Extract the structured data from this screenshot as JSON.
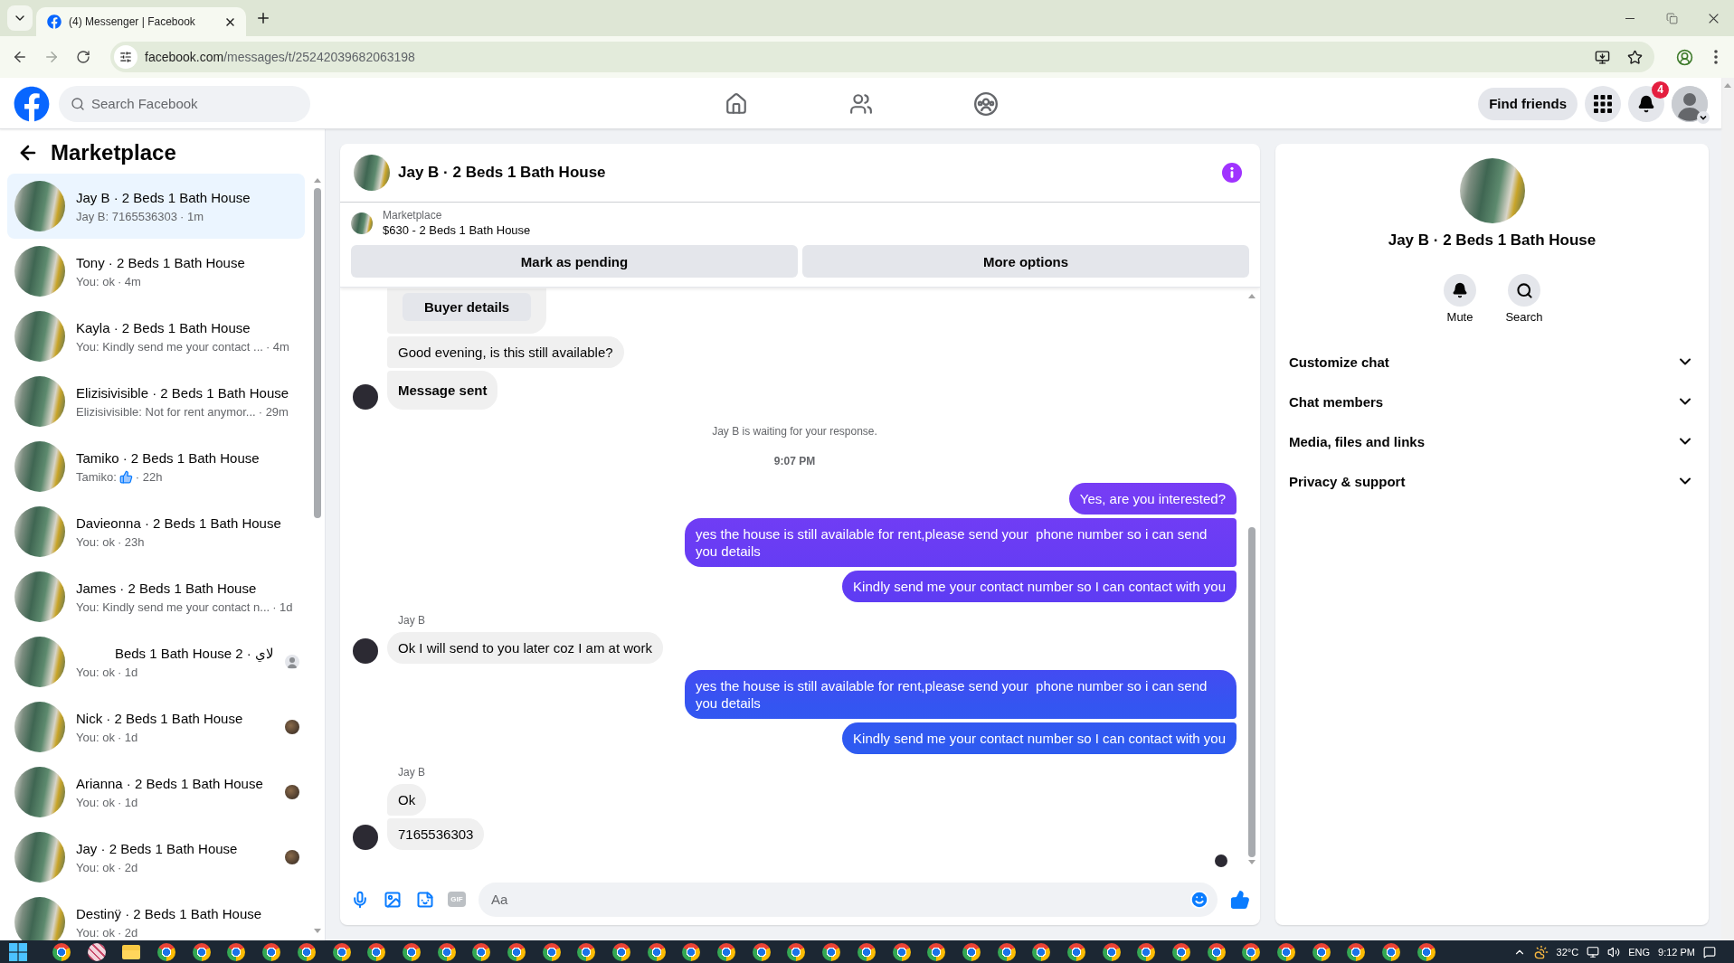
{
  "browser": {
    "tab": {
      "title": "(4) Messenger | Facebook",
      "selected": true
    },
    "address": {
      "domain": "facebook.com",
      "path": "/messages/t/25242039682063198"
    }
  },
  "header": {
    "search": {
      "placeholder": "Search Facebook"
    },
    "nav": [
      {
        "kind": "home",
        "selected": false
      },
      {
        "kind": "friends",
        "selected": false
      },
      {
        "kind": "groups",
        "selected": false
      }
    ],
    "find_friends": "Find friends",
    "notification_count": "4"
  },
  "sidebar": {
    "title": "Marketplace",
    "conversations": [
      {
        "title": "Jay B · 2 Beds 1 Bath House",
        "preview": "Jay B: 7165536303",
        "time": "· 1m",
        "kind": "text",
        "seen": false,
        "selected": true
      },
      {
        "title": "Tony · 2 Beds 1 Bath House",
        "preview": "You: ok",
        "time": "· 4m",
        "kind": "text",
        "seen": false,
        "selected": false
      },
      {
        "title": "Kayla · 2 Beds 1 Bath House",
        "preview": "You: Kindly send me your contact ...",
        "time": "· 4m",
        "kind": "text",
        "seen": false,
        "selected": false
      },
      {
        "title": "Elizisivisible · 2 Beds 1 Bath House",
        "preview": "Elizisivisible: Not for rent anymor...",
        "time": "· 29m",
        "kind": "text",
        "seen": false,
        "selected": false
      },
      {
        "title": "Tamiko · 2 Beds 1 Bath House",
        "preview": "Tamiko:",
        "time": "· 22h",
        "kind": "like",
        "seen": false,
        "selected": false
      },
      {
        "title": "Davieonna · 2 Beds 1 Bath House",
        "preview": "You: ok",
        "time": "· 23h",
        "kind": "text",
        "seen": false,
        "selected": false
      },
      {
        "title": "James · 2 Beds 1 Bath House",
        "preview": "You: Kindly send me your contact n...",
        "time": "· 1d",
        "kind": "text",
        "seen": false,
        "selected": false
      },
      {
        "title": "لاي · 2 Beds 1 Bath House",
        "preview": "You: ok",
        "time": "· 1d",
        "kind": "text",
        "seen": true,
        "seen_photo": false,
        "selected": false
      },
      {
        "title": "Nick · 2 Beds 1 Bath House",
        "preview": "You: ok",
        "time": "· 1d",
        "kind": "text",
        "seen": true,
        "seen_photo": true,
        "selected": false
      },
      {
        "title": "Arianna · 2 Beds 1 Bath House",
        "preview": "You: ok",
        "time": "· 1d",
        "kind": "text",
        "seen": true,
        "seen_photo": true,
        "selected": false
      },
      {
        "title": "Jay · 2 Beds 1 Bath House",
        "preview": "You: ok",
        "time": "· 2d",
        "kind": "text",
        "seen": true,
        "seen_photo": true,
        "selected": false
      },
      {
        "title": "Destinÿ · 2 Beds 1 Bath House",
        "preview": "You: ok",
        "time": "· 2d",
        "kind": "text",
        "seen": false,
        "selected": false
      }
    ]
  },
  "chat": {
    "title": "Jay B · 2 Beds 1 Bath House",
    "listing": {
      "source": "Marketplace",
      "title": "$630 - 2 Beds 1 Bath House"
    },
    "actions": [
      "Mark as pending",
      "More options"
    ],
    "messages": [
      {
        "kind": "card",
        "button": "Buyer details"
      },
      {
        "kind": "incoming",
        "text": "Good evening, is this still available?",
        "show_avatar": false
      },
      {
        "kind": "notice",
        "text": "Message sent",
        "show_avatar": true
      },
      {
        "kind": "status",
        "text": "Jay B is waiting for your response."
      },
      {
        "kind": "time",
        "text": "9:07 PM"
      },
      {
        "kind": "outgoing",
        "text": "Yes, are you interested?"
      },
      {
        "kind": "outgoing",
        "text": "yes the house is still available for rent,please send your  phone number so i can send you details"
      },
      {
        "kind": "outgoing",
        "text": "Kindly send me your contact number so I can contact with you"
      },
      {
        "kind": "sender",
        "text": "Jay B"
      },
      {
        "kind": "incoming",
        "text": "Ok I will send to you later coz I am at work",
        "show_avatar": true
      },
      {
        "kind": "outgoing",
        "text": "yes the house is still available for rent,please send your  phone number so i can send you details"
      },
      {
        "kind": "outgoing",
        "text": "Kindly send me your contact number so I can contact with you"
      },
      {
        "kind": "sender",
        "text": "Jay B"
      },
      {
        "kind": "incoming",
        "text": "Ok",
        "show_avatar": false
      },
      {
        "kind": "incoming",
        "text": "7165536303",
        "show_avatar": true
      },
      {
        "kind": "seen"
      }
    ],
    "composer": {
      "gif": "GIF",
      "placeholder": "Aa"
    }
  },
  "details": {
    "title": "Jay B · 2 Beds 1 Bath House",
    "actions": [
      {
        "kind": "mute",
        "label": "Mute"
      },
      {
        "kind": "search",
        "label": "Search"
      }
    ],
    "sections": [
      {
        "label": "Customize chat",
        "expanded": false
      },
      {
        "label": "Chat members",
        "expanded": false
      },
      {
        "label": "Media, files and links",
        "expanded": false
      },
      {
        "label": "Privacy & support",
        "expanded": false
      }
    ]
  },
  "taskbar": {
    "temperature": "32°C",
    "language": "ENG",
    "time": "9:12 PM"
  }
}
